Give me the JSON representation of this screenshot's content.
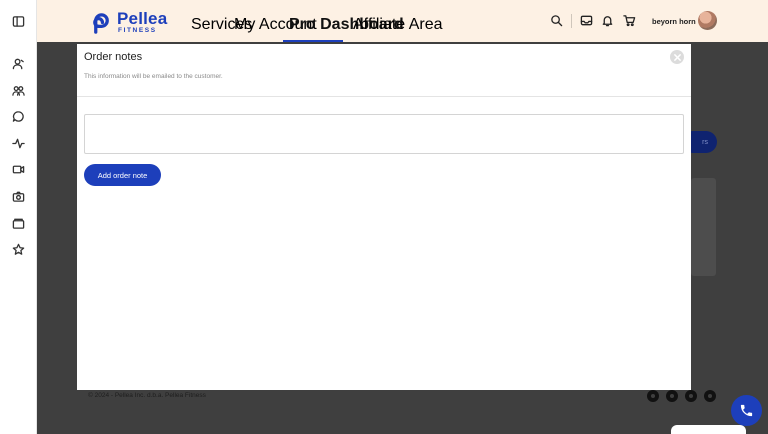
{
  "brand": {
    "name": "Pellea",
    "tagline": "FITNESS",
    "color": "#1d3fbb"
  },
  "nav": {
    "items": [
      {
        "label": "Services",
        "active": false
      },
      {
        "label": "My Account",
        "active": false
      },
      {
        "label": "Pro Dashboard",
        "active": true
      },
      {
        "label": "Affiliate Area",
        "active": false
      }
    ]
  },
  "header": {
    "icons": [
      "search-icon",
      "inbox-icon",
      "bell-icon",
      "cart-icon"
    ],
    "user_name": "beyorn horn"
  },
  "sidebar": {
    "icons": [
      "sidebar-toggle-icon",
      "user-icon",
      "users-icon",
      "chat-icon",
      "activity-icon",
      "video-icon",
      "camera-icon",
      "folder-icon",
      "star-icon"
    ]
  },
  "background": {
    "button_label": "rs",
    "footer_text": "© 2024 - Pellea Inc. d.b.a. Pellea Fitness",
    "social_icons": [
      "facebook-icon",
      "instagram-icon",
      "linkedin-icon",
      "twitter-icon"
    ]
  },
  "modal": {
    "title": "Order notes",
    "subtitle": "This information will be emailed to the customer.",
    "note_value": "",
    "add_button_label": "Add order note"
  }
}
